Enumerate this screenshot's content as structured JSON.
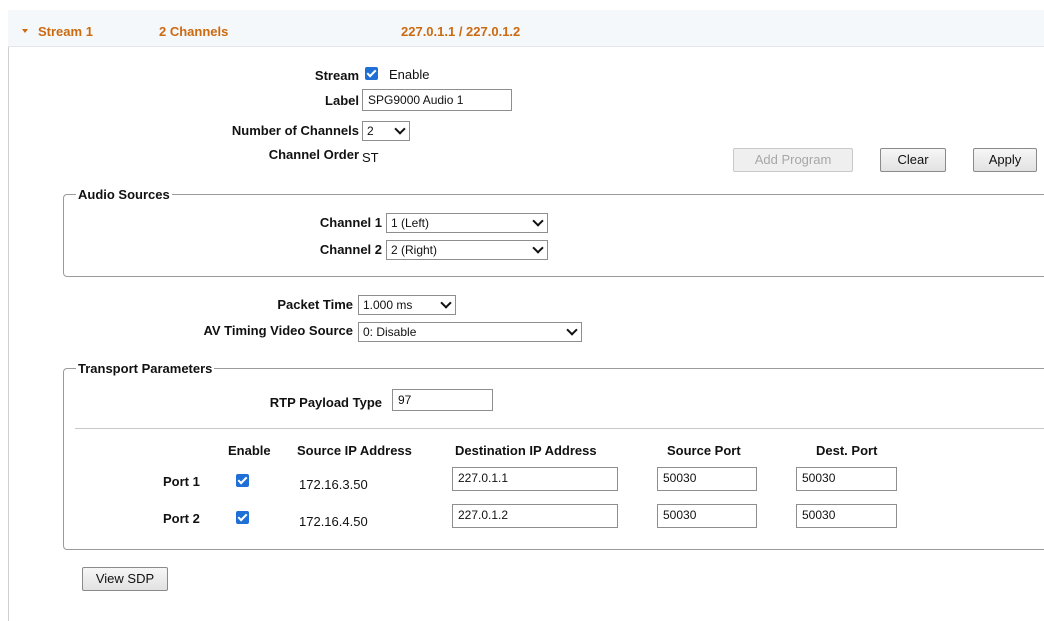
{
  "header": {
    "stream": "Stream 1",
    "channels": "2 Channels",
    "addresses": "227.0.1.1 / 227.0.1.2"
  },
  "stream_row": {
    "label": "Stream",
    "checkbox_label": "Enable"
  },
  "label_row": {
    "label": "Label",
    "value": "SPG9000 Audio 1"
  },
  "num_channels": {
    "label": "Number of Channels",
    "value": "2"
  },
  "channel_order": {
    "label": "Channel Order",
    "value": "ST"
  },
  "buttons": {
    "add_program": "Add Program",
    "clear": "Clear",
    "apply": "Apply",
    "view_sdp": "View SDP"
  },
  "audio_sources": {
    "legend": "Audio Sources",
    "channel1_label": "Channel 1",
    "channel1_value": "1 (Left)",
    "channel2_label": "Channel 2",
    "channel2_value": "2 (Right)"
  },
  "packet_time": {
    "label": "Packet Time",
    "value": "1.000 ms"
  },
  "av_timing": {
    "label": "AV Timing Video Source",
    "value": "0: Disable"
  },
  "transport": {
    "legend": "Transport Parameters",
    "rtp_label": "RTP Payload Type",
    "rtp_value": "97",
    "columns": {
      "enable": "Enable",
      "source_ip": "Source IP Address",
      "dest_ip": "Destination IP Address",
      "source_port": "Source Port",
      "dest_port": "Dest. Port"
    },
    "ports": [
      {
        "name": "Port 1",
        "enabled": true,
        "source_ip": "172.16.3.50",
        "dest_ip": "227.0.1.1",
        "source_port": "50030",
        "dest_port": "50030"
      },
      {
        "name": "Port 2",
        "enabled": true,
        "source_ip": "172.16.4.50",
        "dest_ip": "227.0.1.2",
        "source_port": "50030",
        "dest_port": "50030"
      }
    ]
  },
  "colors": {
    "header_text": "#cc6a10",
    "checkbox": "#1f6fd6"
  }
}
